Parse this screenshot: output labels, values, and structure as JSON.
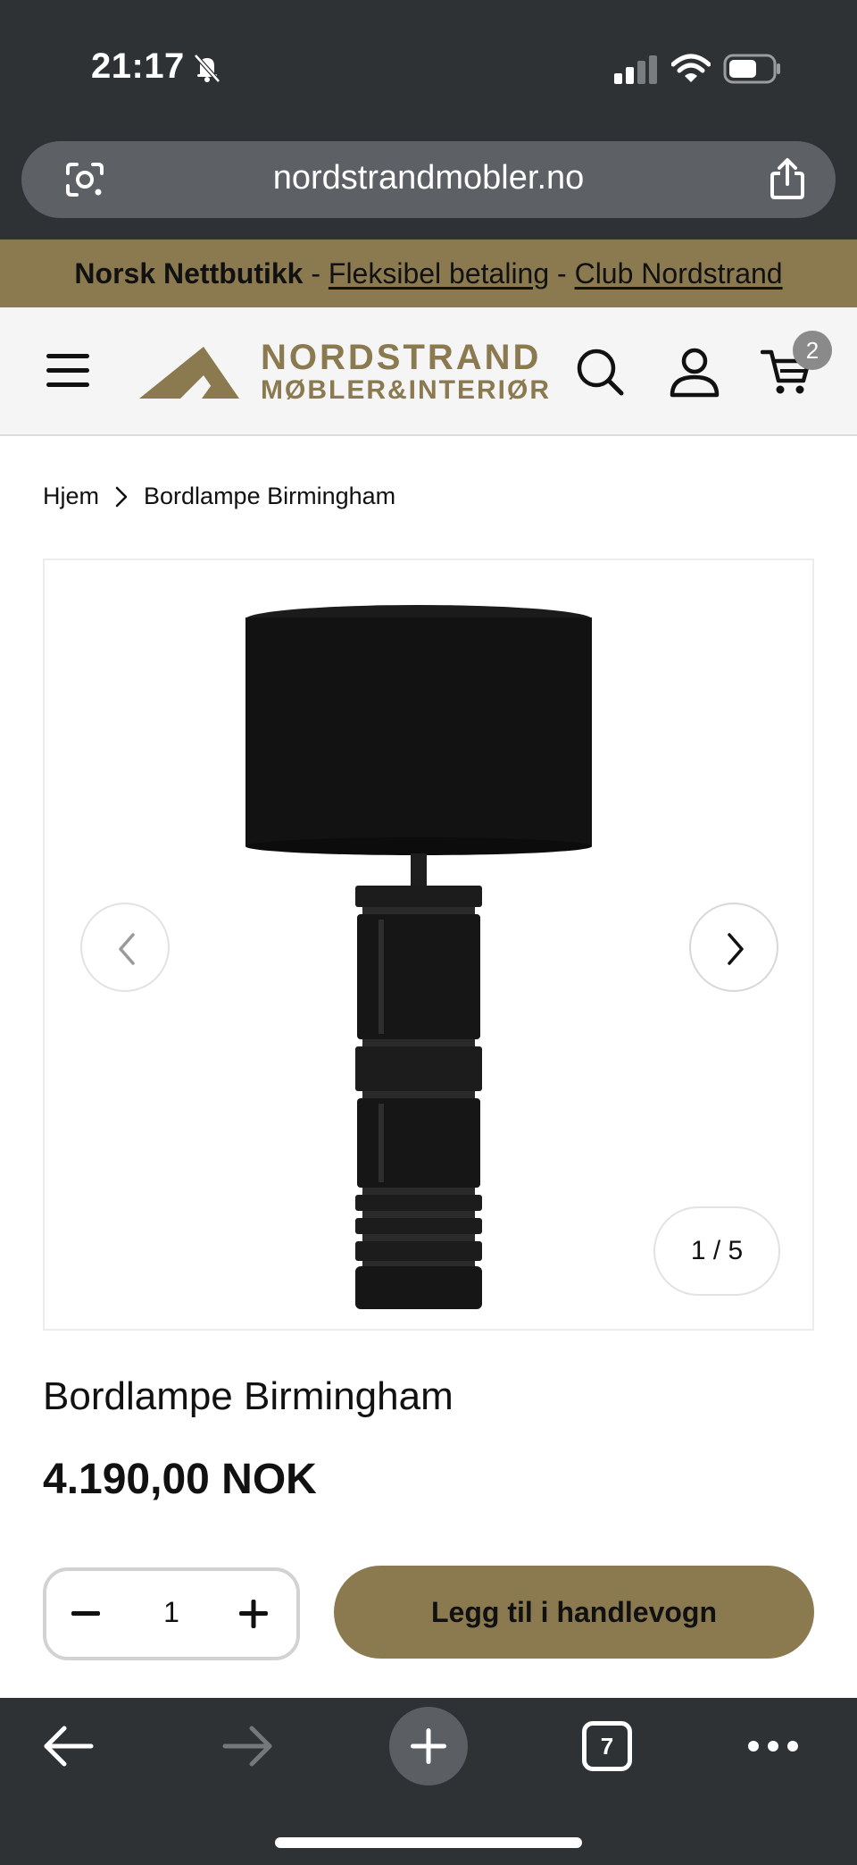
{
  "status_bar": {
    "time": "21:17"
  },
  "browser": {
    "url": "nordstrandmobler.no",
    "tab_count": "7"
  },
  "promo": {
    "strong": "Norsk Nettbutikk",
    "separator": " - ",
    "link1": "Fleksibel betaling",
    "link2": "Club Nordstrand"
  },
  "header": {
    "logo_line1": "NORDSTRAND",
    "logo_line2": "MØBLER&INTERIØR",
    "cart_count": "2"
  },
  "breadcrumb": {
    "home": "Hjem",
    "current": "Bordlampe Birmingham"
  },
  "gallery": {
    "counter": "1 / 5"
  },
  "product": {
    "title": "Bordlampe Birmingham",
    "price": "4.190,00 NOK",
    "quantity": "1",
    "add_to_cart_label": "Legg til i handlevogn"
  },
  "colors": {
    "brand_gold": "#8b7a50",
    "chrome_dark": "#2f3235"
  }
}
